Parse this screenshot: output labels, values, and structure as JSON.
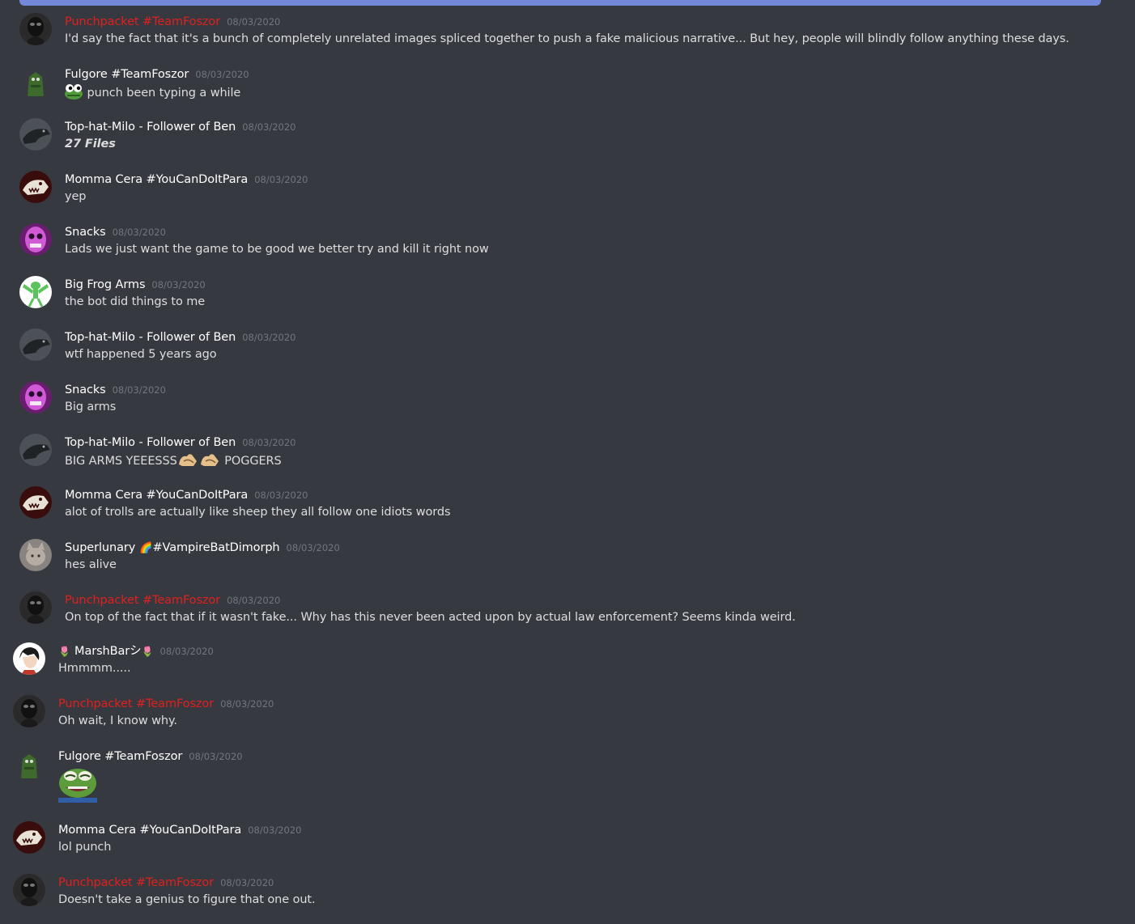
{
  "messages": [
    {
      "author": "Punchpacket #TeamFoszor",
      "time": "08/03/2020",
      "text": "I'd say the fact that it's a bunch of completely unrelated images spliced together to push a fake malicious narrative... But hey, people will blindly follow anything these days."
    },
    {
      "author": "Fulgore #TeamFoszor",
      "time": "08/03/2020",
      "text": "punch been typing a while"
    },
    {
      "author": "Top-hat-Milo - Follower of Ben",
      "time": "08/03/2020",
      "text": "27 Files"
    },
    {
      "author": "Momma Cera #YouCanDoItPara",
      "time": "08/03/2020",
      "text": "yep"
    },
    {
      "author": "Snacks",
      "time": "08/03/2020",
      "text": "Lads we just want the game to be good we better try and kill it right now"
    },
    {
      "author": "Big Frog Arms",
      "time": "08/03/2020",
      "text": "the bot did things to me"
    },
    {
      "author": "Top-hat-Milo - Follower of Ben",
      "time": "08/03/2020",
      "text": "wtf happened 5 years ago"
    },
    {
      "author": "Snacks",
      "time": "08/03/2020",
      "text": "Big arms"
    },
    {
      "author": "Top-hat-Milo - Follower of Ben",
      "time": "08/03/2020",
      "text": "BIG ARMS YEEESSS",
      "text_after": "POGGERS"
    },
    {
      "author": "Momma Cera #YouCanDoItPara",
      "time": "08/03/2020",
      "text": "alot of trolls are actually like sheep they all follow one idiots words"
    },
    {
      "author": "Superlunary",
      "author_suffix": "#VampireBatDimorph",
      "time": "08/03/2020",
      "text": "hes alive"
    },
    {
      "author": "Punchpacket #TeamFoszor",
      "time": "08/03/2020",
      "text": "On top of the fact that if it wasn't fake... Why has this never been acted upon by actual law enforcement? Seems kinda weird."
    },
    {
      "author": "MarshBarシ",
      "time": "08/03/2020",
      "text": "Hmmmm....."
    },
    {
      "author": "Punchpacket #TeamFoszor",
      "time": "08/03/2020",
      "text": "Oh wait, I know why."
    },
    {
      "author": "Fulgore #TeamFoszor",
      "time": "08/03/2020",
      "text": ""
    },
    {
      "author": "Momma Cera #YouCanDoItPara",
      "time": "08/03/2020",
      "text": "lol punch"
    },
    {
      "author": "Punchpacket #TeamFoszor",
      "time": "08/03/2020",
      "text": "Doesn't take a genius to figure that one out."
    }
  ],
  "colors": {
    "background": "#36393f",
    "username": "#ffffff",
    "username_role_red": "#e0201e",
    "timestamp": "#72767d",
    "message_text": "#dcddde",
    "top_bar": "#7289da"
  }
}
